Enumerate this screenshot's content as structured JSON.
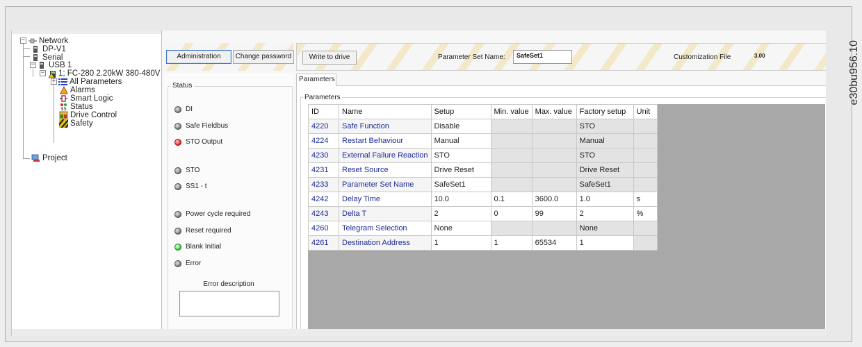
{
  "doc_code": "e30bu956.10",
  "tree": {
    "network": "Network",
    "dpv1": "DP-V1",
    "serial": "Serial",
    "usb": "USB 1",
    "drive": "1; FC-280 2.20kW 380-480V",
    "all_parameters": "All Parameters",
    "alarms": "Alarms",
    "smart_logic": "Smart Logic",
    "status": "Status",
    "drive_control": "Drive Control",
    "safety": "Safety",
    "project": "Project"
  },
  "toolbar": {
    "administration": "Administration",
    "change_password": "Change password",
    "write_to_drive": "Write to drive",
    "pset_label": "Parameter Set Name:",
    "pset_value": "SafeSet1",
    "cust_label": "Customization File",
    "cust_value": "3.00"
  },
  "status": {
    "title": "Status",
    "leds": [
      {
        "label": "DI",
        "color": "gray"
      },
      {
        "label": "Safe Fieldbus",
        "color": "gray"
      },
      {
        "label": "STO Output",
        "color": "red"
      },
      {
        "label": "STO",
        "color": "gray"
      },
      {
        "label": "SS1 - t",
        "color": "gray"
      },
      {
        "label": "Power cycle required",
        "color": "gray"
      },
      {
        "label": "Reset required",
        "color": "gray"
      },
      {
        "label": "Blank Initial",
        "color": "green"
      },
      {
        "label": "Error",
        "color": "gray"
      }
    ],
    "error_description": "Error description"
  },
  "params": {
    "tab": "Parameters",
    "group": "Parameters",
    "columns": [
      "ID",
      "Name",
      "Setup",
      "Min. value",
      "Max. value",
      "Factory setup",
      "Unit"
    ],
    "rows": [
      [
        "4220",
        "Safe Function",
        "Disable",
        "",
        "",
        "STO",
        ""
      ],
      [
        "4224",
        "Restart Behaviour",
        "Manual",
        "",
        "",
        "Manual",
        ""
      ],
      [
        "4230",
        "External Failure Reaction",
        "STO",
        "",
        "",
        "STO",
        ""
      ],
      [
        "4231",
        "Reset Source",
        "Drive Reset",
        "",
        "",
        "Drive Reset",
        ""
      ],
      [
        "4233",
        "Parameter Set Name",
        "SafeSet1",
        "",
        "",
        "SafeSet1",
        ""
      ],
      [
        "4242",
        "Delay Time",
        "10.0",
        "0.1",
        "3600.0",
        "1.0",
        "s"
      ],
      [
        "4243",
        "Delta T",
        "2",
        "0",
        "99",
        "2",
        "%"
      ],
      [
        "4260",
        "Telegram Selection",
        "None",
        "",
        "",
        "None",
        ""
      ],
      [
        "4261",
        "Destination Address",
        "1",
        "1",
        "65534",
        "1",
        ""
      ]
    ]
  },
  "colors": {
    "link_blue": "#1c2a9a",
    "led_red": "#e01b1b",
    "led_green": "#22c322",
    "grid_gray": "#a8a8a8"
  }
}
